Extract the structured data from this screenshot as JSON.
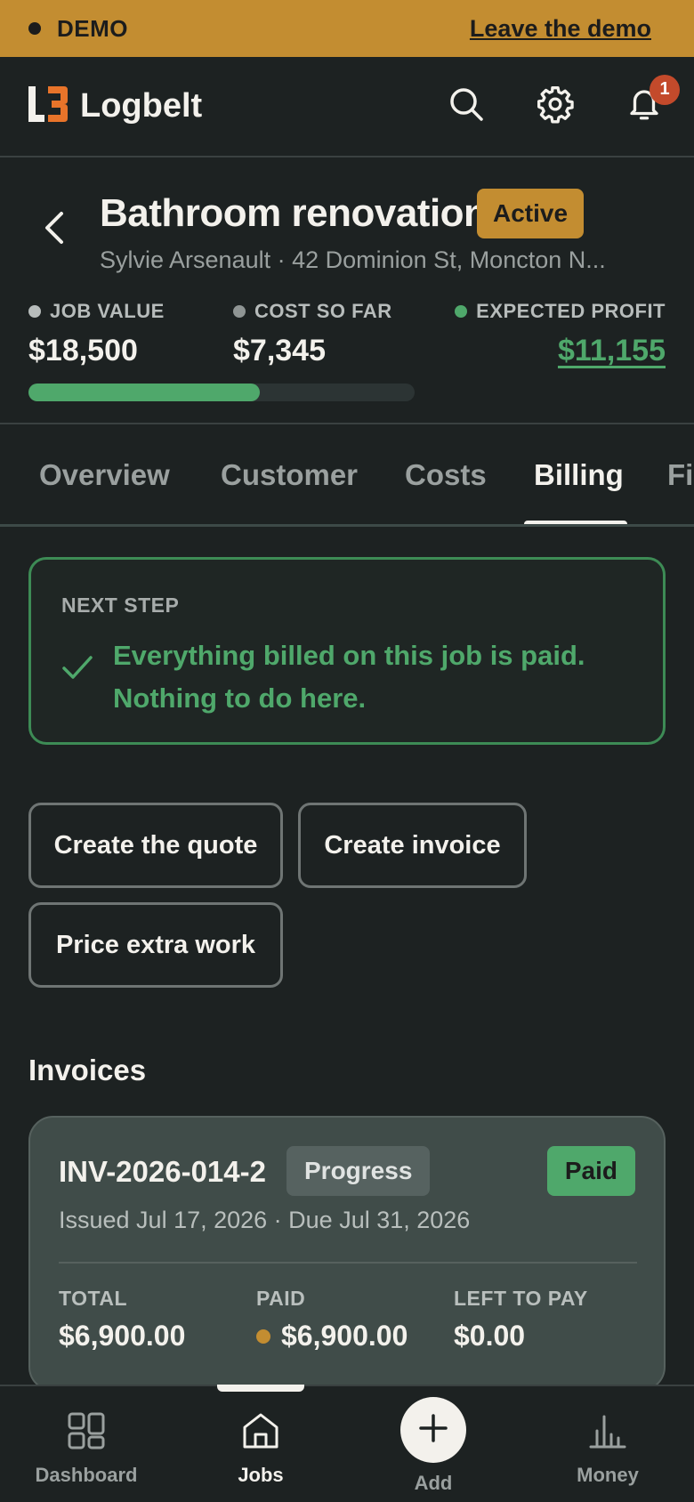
{
  "demo": {
    "label": "DEMO",
    "leave_link": "Leave the demo"
  },
  "header": {
    "brand": "Logbelt",
    "notification_count": "1",
    "icons": [
      "search-icon",
      "gear-icon",
      "bell-icon"
    ]
  },
  "job": {
    "title": "Bathroom renovation",
    "status": "Active",
    "subtitle": "Sylvie Arsenault · 42 Dominion St, Moncton N...",
    "job_value_label": "JOB VALUE",
    "job_value": "$18,500",
    "cost_label": "COST SO FAR",
    "cost": "$7,345",
    "profit_label": "EXPECTED PROFIT",
    "profit": "$11,155",
    "cost_progress_percent": 60
  },
  "tabs": [
    {
      "label": "Overview"
    },
    {
      "label": "Customer"
    },
    {
      "label": "Costs"
    },
    {
      "label": "Billing",
      "active": true
    },
    {
      "label": "Fi"
    }
  ],
  "next_step": {
    "label": "NEXT STEP",
    "message": "Everything billed on this job is paid. Nothing to do here."
  },
  "actions": {
    "create_quote": "Create the quote",
    "create_invoice": "Create invoice",
    "price_extra": "Price extra work"
  },
  "invoices": {
    "title": "Invoices",
    "items": [
      {
        "number": "INV-2026-014-2",
        "type": "Progress",
        "status": "Paid",
        "dates": "Issued Jul 17, 2026 · Due Jul 31, 2026",
        "total_label": "TOTAL",
        "total": "$6,900.00",
        "paid_label": "PAID",
        "paid": "$6,900.00",
        "left_label": "LEFT TO PAY",
        "left": "$0.00"
      }
    ]
  },
  "bottom_nav": [
    {
      "label": "Dashboard"
    },
    {
      "label": "Jobs",
      "active": true
    },
    {
      "label": "Add"
    },
    {
      "label": "Money"
    }
  ],
  "colors": {
    "background": "#1d2222",
    "accent": "#c38d31",
    "success": "#4fa86b",
    "brand_orange": "#e8742a"
  }
}
